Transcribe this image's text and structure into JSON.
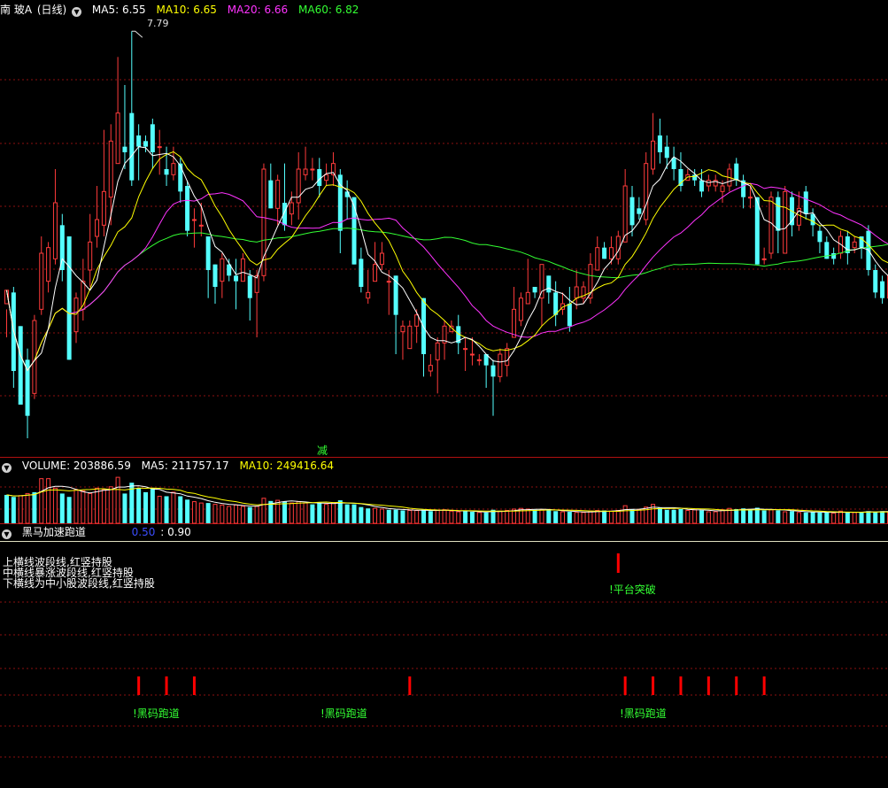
{
  "colors": {
    "up": "#ff3b3b",
    "down": "#54ffff",
    "ma5": "#ffffff",
    "ma10": "#ffff00",
    "ma20": "#ff33ff",
    "ma60": "#33ff33",
    "grid": "#8b1010",
    "signal": "#ff0000",
    "label": "#33ff33"
  },
  "price_header": {
    "stock_name": "南 玻A",
    "period": "(日线)",
    "ma5": "MA5: 6.55",
    "ma10": "MA10: 6.65",
    "ma20": "MA20: 6.66",
    "ma60": "MA60: 6.82",
    "high_label": "7.79",
    "reduce_label": "减"
  },
  "volume_header": {
    "volume": "VOLUME: 203886.59",
    "ma5": "MA5: 211757.17",
    "ma10": "MA10: 249416.64"
  },
  "indicator_header": {
    "name": "黑马加速跑道",
    "value_blue": "0.50",
    "value_white": ": 0.90"
  },
  "notes": [
    "上横线波段线,红竖持股",
    "中横线暴涨波段线,红竖持股",
    "下横线为中小股波段线,红竖持股"
  ],
  "signals": {
    "platform_label": "!平台突破",
    "dark_horse_1": "!黑码跑道",
    "dark_horse_2": "!黑码跑道",
    "dark_horse_3": "!黑码跑道"
  },
  "chart_data": {
    "type": "candlestick",
    "y_axis": {
      "min": 4.3,
      "max": 7.9
    },
    "candles": [
      [
        5.35,
        5.47,
        5.3,
        5.05
      ],
      [
        5.45,
        4.75,
        5.5,
        4.6
      ],
      [
        5.15,
        4.45,
        5.15,
        4.45
      ],
      [
        4.85,
        4.35,
        4.95,
        4.15
      ],
      [
        4.55,
        5.2,
        5.25,
        4.5
      ],
      [
        5.3,
        5.8,
        5.95,
        5.25
      ],
      [
        5.55,
        5.85,
        5.9,
        5.45
      ],
      [
        5.75,
        6.25,
        6.55,
        5.7
      ],
      [
        6.05,
        5.65,
        6.15,
        5.55
      ],
      [
        5.95,
        4.85,
        5.95,
        4.85
      ],
      [
        5.1,
        5.4,
        5.45,
        5.0
      ],
      [
        5.3,
        5.55,
        5.75,
        5.2
      ],
      [
        5.65,
        5.9,
        6.15,
        5.5
      ],
      [
        5.95,
        6.1,
        6.4,
        5.85
      ],
      [
        6.05,
        6.35,
        6.9,
        5.95
      ],
      [
        6.3,
        6.8,
        6.95,
        6.05
      ],
      [
        6.6,
        7.05,
        7.55,
        6.6
      ],
      [
        6.75,
        6.7,
        7.3,
        6.55
      ],
      [
        7.05,
        6.45,
        7.78,
        6.4
      ],
      [
        6.85,
        6.75,
        6.95,
        6.45
      ],
      [
        6.8,
        6.75,
        6.85,
        6.7
      ],
      [
        6.95,
        6.7,
        7.0,
        6.55
      ],
      [
        6.75,
        6.75,
        6.9,
        6.5
      ],
      [
        6.55,
        6.5,
        6.75,
        6.4
      ],
      [
        6.5,
        6.6,
        6.75,
        6.45
      ],
      [
        6.6,
        6.35,
        6.65,
        6.25
      ],
      [
        6.4,
        6.0,
        6.45,
        5.95
      ],
      [
        6.1,
        6.1,
        6.2,
        5.85
      ],
      [
        6.05,
        6.05,
        6.25,
        5.95
      ],
      [
        5.95,
        5.65,
        5.95,
        5.4
      ],
      [
        5.7,
        5.5,
        5.7,
        5.35
      ],
      [
        5.55,
        5.75,
        5.8,
        5.4
      ],
      [
        5.7,
        5.6,
        5.75,
        5.55
      ],
      [
        5.6,
        5.55,
        5.75,
        5.3
      ],
      [
        5.55,
        5.75,
        5.8,
        5.55
      ],
      [
        5.6,
        5.4,
        5.65,
        5.2
      ],
      [
        5.45,
        5.6,
        5.65,
        5.05
      ],
      [
        5.6,
        6.55,
        6.6,
        5.55
      ],
      [
        6.45,
        6.2,
        6.6,
        6.2
      ],
      [
        6.2,
        6.45,
        6.5,
        6.05
      ],
      [
        6.25,
        6.05,
        6.6,
        6.0
      ],
      [
        6.15,
        6.25,
        6.35,
        6.05
      ],
      [
        6.25,
        6.55,
        6.7,
        6.1
      ],
      [
        6.5,
        6.55,
        6.75,
        6.45
      ],
      [
        6.55,
        6.55,
        6.65,
        6.45
      ],
      [
        6.55,
        6.4,
        6.65,
        6.3
      ],
      [
        6.45,
        6.5,
        6.6,
        6.4
      ],
      [
        6.5,
        6.6,
        6.7,
        6.4
      ],
      [
        6.5,
        6.0,
        6.55,
        5.8
      ],
      [
        6.35,
        6.3,
        6.45,
        6.1
      ],
      [
        6.3,
        5.7,
        6.3,
        5.7
      ],
      [
        5.75,
        5.5,
        5.85,
        5.45
      ],
      [
        5.4,
        5.45,
        5.65,
        5.35
      ],
      [
        5.55,
        5.7,
        5.9,
        5.55
      ],
      [
        5.7,
        5.8,
        5.9,
        5.65
      ],
      [
        5.55,
        5.55,
        5.65,
        5.25
      ],
      [
        5.6,
        5.25,
        5.6,
        4.9
      ],
      [
        5.1,
        5.15,
        5.2,
        4.85
      ],
      [
        4.95,
        5.15,
        5.2,
        4.95
      ],
      [
        5.15,
        5.25,
        5.3,
        5.0
      ],
      [
        5.4,
        4.9,
        5.4,
        4.7
      ],
      [
        4.75,
        4.8,
        4.9,
        4.7
      ],
      [
        4.85,
        5.0,
        5.05,
        4.55
      ],
      [
        5.0,
        5.15,
        5.2,
        4.85
      ],
      [
        5.1,
        5.15,
        5.2,
        5.1
      ],
      [
        5.15,
        5.0,
        5.25,
        4.9
      ],
      [
        4.95,
        4.95,
        5.05,
        4.75
      ],
      [
        4.9,
        4.9,
        5.05,
        4.8
      ],
      [
        4.85,
        4.85,
        4.9,
        4.8
      ],
      [
        4.9,
        4.8,
        4.9,
        4.6
      ],
      [
        4.8,
        4.7,
        4.85,
        4.35
      ],
      [
        4.7,
        4.9,
        4.95,
        4.65
      ],
      [
        4.8,
        4.95,
        5.0,
        4.7
      ],
      [
        5.05,
        5.3,
        5.5,
        5.05
      ],
      [
        5.2,
        5.4,
        5.45,
        5.15
      ],
      [
        5.35,
        5.45,
        5.75,
        5.35
      ],
      [
        5.5,
        5.45,
        5.5,
        5.4
      ],
      [
        5.4,
        5.7,
        5.65,
        5.15
      ],
      [
        5.6,
        5.45,
        5.6,
        5.35
      ],
      [
        5.45,
        5.25,
        5.55,
        5.15
      ],
      [
        5.3,
        5.35,
        5.45,
        5.25
      ],
      [
        5.35,
        5.15,
        5.5,
        5.1
      ],
      [
        5.4,
        5.5,
        5.65,
        5.3
      ],
      [
        5.4,
        5.5,
        5.55,
        5.35
      ],
      [
        5.4,
        5.7,
        5.8,
        5.35
      ],
      [
        5.65,
        5.85,
        5.95,
        5.65
      ],
      [
        5.85,
        5.75,
        5.9,
        5.75
      ],
      [
        5.75,
        5.85,
        5.95,
        5.7
      ],
      [
        5.75,
        5.95,
        6.0,
        5.7
      ],
      [
        5.9,
        6.4,
        6.55,
        5.9
      ],
      [
        6.3,
        6.05,
        6.4,
        5.95
      ],
      [
        6.2,
        6.15,
        6.3,
        6.1
      ],
      [
        6.1,
        6.6,
        6.7,
        6.05
      ],
      [
        6.55,
        6.8,
        7.05,
        6.5
      ],
      [
        6.85,
        6.7,
        7.0,
        6.6
      ],
      [
        6.75,
        6.65,
        6.85,
        6.55
      ],
      [
        6.65,
        6.55,
        6.75,
        6.45
      ],
      [
        6.55,
        6.4,
        6.7,
        6.35
      ],
      [
        6.45,
        6.5,
        6.55,
        6.45
      ],
      [
        6.5,
        6.45,
        6.55,
        6.4
      ],
      [
        6.45,
        6.35,
        6.55,
        6.3
      ],
      [
        6.4,
        6.45,
        6.5,
        6.35
      ],
      [
        6.4,
        6.45,
        6.5,
        6.35
      ],
      [
        6.35,
        6.4,
        6.45,
        6.25
      ],
      [
        6.4,
        6.55,
        6.6,
        6.35
      ],
      [
        6.6,
        6.45,
        6.65,
        6.4
      ],
      [
        6.45,
        6.3,
        6.5,
        6.2
      ],
      [
        6.3,
        6.3,
        6.4,
        6.2
      ],
      [
        6.3,
        5.7,
        6.3,
        5.7
      ],
      [
        5.75,
        5.75,
        5.85,
        5.7
      ],
      [
        5.8,
        6.3,
        6.35,
        5.75
      ],
      [
        6.3,
        6.0,
        6.35,
        5.8
      ],
      [
        5.8,
        6.35,
        6.4,
        5.8
      ],
      [
        6.3,
        6.05,
        6.35,
        5.95
      ],
      [
        6.05,
        6.2,
        6.35,
        6.0
      ],
      [
        6.35,
        6.15,
        6.4,
        6.1
      ],
      [
        6.15,
        6.05,
        6.2,
        5.95
      ],
      [
        6.0,
        5.9,
        6.05,
        5.8
      ],
      [
        5.9,
        5.75,
        5.95,
        5.75
      ],
      [
        5.8,
        5.75,
        5.85,
        5.7
      ],
      [
        5.8,
        5.95,
        6.0,
        5.75
      ],
      [
        5.95,
        5.8,
        6.0,
        5.7
      ],
      [
        5.85,
        5.9,
        5.95,
        5.8
      ],
      [
        5.95,
        5.85,
        5.95,
        5.75
      ],
      [
        6.0,
        5.65,
        6.05,
        5.6
      ],
      [
        5.65,
        5.45,
        5.7,
        5.4
      ],
      [
        5.55,
        5.4,
        5.6,
        5.35
      ],
      [
        5.4,
        5.6,
        5.6,
        5.35
      ]
    ],
    "volume_y_max": 380000,
    "volumes": [
      [
        210000,
        0
      ],
      [
        195000,
        0
      ],
      [
        205000,
        1
      ],
      [
        220000,
        1
      ],
      [
        230000,
        0
      ],
      [
        330000,
        1
      ],
      [
        330000,
        1
      ],
      [
        260000,
        1
      ],
      [
        220000,
        0
      ],
      [
        195000,
        0
      ],
      [
        250000,
        1
      ],
      [
        240000,
        1
      ],
      [
        220000,
        1
      ],
      [
        260000,
        1
      ],
      [
        250000,
        1
      ],
      [
        270000,
        1
      ],
      [
        340000,
        1
      ],
      [
        220000,
        0
      ],
      [
        300000,
        0
      ],
      [
        260000,
        0
      ],
      [
        230000,
        0
      ],
      [
        260000,
        0
      ],
      [
        200000,
        1
      ],
      [
        200000,
        0
      ],
      [
        230000,
        1
      ],
      [
        200000,
        0
      ],
      [
        175000,
        0
      ],
      [
        160000,
        1
      ],
      [
        150000,
        1
      ],
      [
        150000,
        0
      ],
      [
        140000,
        1
      ],
      [
        135000,
        1
      ],
      [
        125000,
        1
      ],
      [
        135000,
        1
      ],
      [
        125000,
        1
      ],
      [
        120000,
        0
      ],
      [
        125000,
        1
      ],
      [
        185000,
        1
      ],
      [
        165000,
        0
      ],
      [
        170000,
        1
      ],
      [
        160000,
        0
      ],
      [
        150000,
        1
      ],
      [
        160000,
        1
      ],
      [
        150000,
        1
      ],
      [
        140000,
        0
      ],
      [
        150000,
        0
      ],
      [
        140000,
        1
      ],
      [
        150000,
        1
      ],
      [
        170000,
        0
      ],
      [
        140000,
        0
      ],
      [
        140000,
        0
      ],
      [
        120000,
        0
      ],
      [
        110000,
        0
      ],
      [
        110000,
        1
      ],
      [
        105000,
        1
      ],
      [
        100000,
        0
      ],
      [
        100000,
        0
      ],
      [
        95000,
        0
      ],
      [
        95000,
        1
      ],
      [
        95000,
        1
      ],
      [
        100000,
        0
      ],
      [
        90000,
        0
      ],
      [
        95000,
        1
      ],
      [
        100000,
        1
      ],
      [
        90000,
        1
      ],
      [
        85000,
        1
      ],
      [
        90000,
        0
      ],
      [
        85000,
        0
      ],
      [
        80000,
        1
      ],
      [
        80000,
        0
      ],
      [
        100000,
        0
      ],
      [
        90000,
        1
      ],
      [
        95000,
        1
      ],
      [
        105000,
        1
      ],
      [
        110000,
        1
      ],
      [
        105000,
        1
      ],
      [
        100000,
        0
      ],
      [
        100000,
        1
      ],
      [
        95000,
        0
      ],
      [
        90000,
        0
      ],
      [
        85000,
        1
      ],
      [
        85000,
        0
      ],
      [
        80000,
        1
      ],
      [
        80000,
        1
      ],
      [
        90000,
        1
      ],
      [
        95000,
        1
      ],
      [
        95000,
        0
      ],
      [
        90000,
        1
      ],
      [
        95000,
        1
      ],
      [
        130000,
        1
      ],
      [
        105000,
        0
      ],
      [
        100000,
        1
      ],
      [
        120000,
        1
      ],
      [
        140000,
        1
      ],
      [
        115000,
        0
      ],
      [
        100000,
        0
      ],
      [
        100000,
        0
      ],
      [
        105000,
        0
      ],
      [
        95000,
        1
      ],
      [
        100000,
        1
      ],
      [
        95000,
        0
      ],
      [
        85000,
        1
      ],
      [
        85000,
        1
      ],
      [
        100000,
        1
      ],
      [
        110000,
        1
      ],
      [
        105000,
        0
      ],
      [
        110000,
        0
      ],
      [
        95000,
        0
      ],
      [
        115000,
        0
      ],
      [
        95000,
        0
      ],
      [
        100000,
        1
      ],
      [
        95000,
        0
      ],
      [
        85000,
        1
      ],
      [
        90000,
        0
      ],
      [
        80000,
        1
      ],
      [
        80000,
        0
      ],
      [
        85000,
        0
      ],
      [
        80000,
        0
      ],
      [
        80000,
        0
      ],
      [
        75000,
        1
      ],
      [
        90000,
        1
      ],
      [
        80000,
        0
      ],
      [
        80000,
        1
      ],
      [
        85000,
        0
      ],
      [
        90000,
        0
      ],
      [
        85000,
        0
      ],
      [
        90000,
        0
      ],
      [
        85000,
        1
      ]
    ],
    "indicator_bars": {
      "top_row": [
        88
      ],
      "bottom_row": [
        19,
        23,
        27,
        58,
        89,
        93,
        97,
        101,
        105,
        109
      ]
    }
  }
}
